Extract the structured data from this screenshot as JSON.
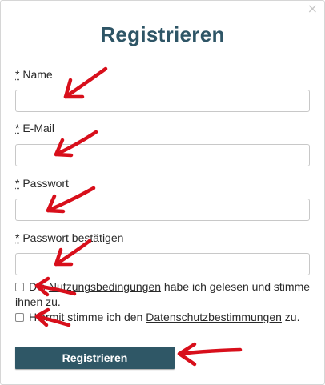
{
  "dialog": {
    "title": "Registrieren",
    "close_icon": "×"
  },
  "fields": [
    {
      "required_mark": "*",
      "label": "Name",
      "value": ""
    },
    {
      "required_mark": "*",
      "label": "E-Mail",
      "value": ""
    },
    {
      "required_mark": "*",
      "label": "Passwort",
      "value": ""
    },
    {
      "required_mark": "*",
      "label": "Passwort bestätigen",
      "value": ""
    }
  ],
  "consents": [
    {
      "checked": false,
      "prefix": "Die ",
      "link": "Nutzungsbedingungen",
      "suffix": " habe ich gelesen und stimme ihnen zu."
    },
    {
      "checked": false,
      "prefix": "Hiermit stimme ich den ",
      "link": "Datenschutzbestimmungen",
      "suffix": " zu."
    }
  ],
  "submit": {
    "label": "Registrieren"
  },
  "colors": {
    "accent": "#2f5766",
    "title": "#2e5566",
    "arrow": "#d80f1b"
  },
  "icons": {
    "close": "close-icon",
    "annotation": "red-arrow-icon"
  }
}
